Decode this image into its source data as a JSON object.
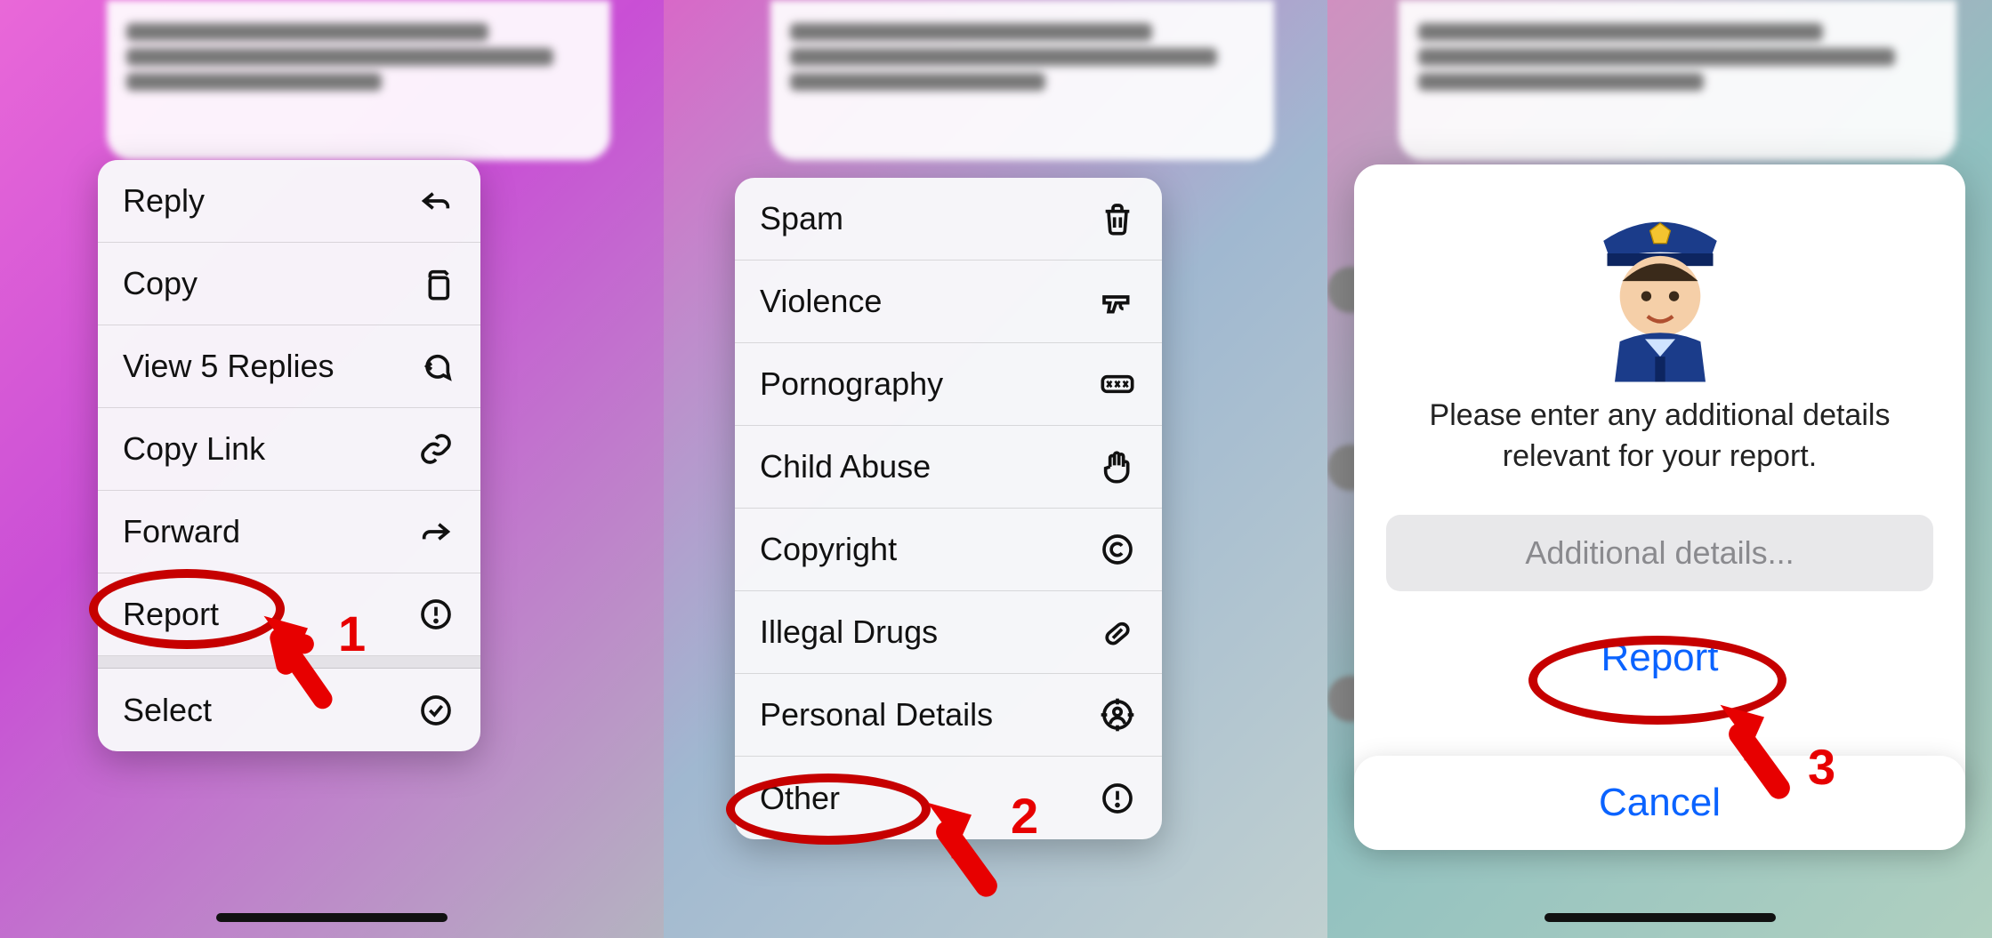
{
  "panel1": {
    "menu": {
      "items": [
        {
          "label": "Reply",
          "icon": "reply"
        },
        {
          "label": "Copy",
          "icon": "copy"
        },
        {
          "label": "View 5 Replies",
          "icon": "replies"
        },
        {
          "label": "Copy Link",
          "icon": "link"
        },
        {
          "label": "Forward",
          "icon": "forward"
        },
        {
          "label": "Report",
          "icon": "alert"
        }
      ],
      "secondary": [
        {
          "label": "Select",
          "icon": "check"
        }
      ]
    },
    "annotation_number": "1"
  },
  "panel2": {
    "menu": {
      "items": [
        {
          "label": "Spam",
          "icon": "trash"
        },
        {
          "label": "Violence",
          "icon": "gun"
        },
        {
          "label": "Pornography",
          "icon": "xxx"
        },
        {
          "label": "Child Abuse",
          "icon": "hand"
        },
        {
          "label": "Copyright",
          "icon": "copyright"
        },
        {
          "label": "Illegal Drugs",
          "icon": "pill"
        },
        {
          "label": "Personal Details",
          "icon": "person-target"
        },
        {
          "label": "Other",
          "icon": "alert"
        }
      ]
    },
    "annotation_number": "2"
  },
  "panel3": {
    "prompt_line1": "Please enter any additional details",
    "prompt_line2": "relevant for your report.",
    "input_placeholder": "Additional details...",
    "report_button": "Report",
    "cancel_button": "Cancel",
    "annotation_number": "3"
  }
}
